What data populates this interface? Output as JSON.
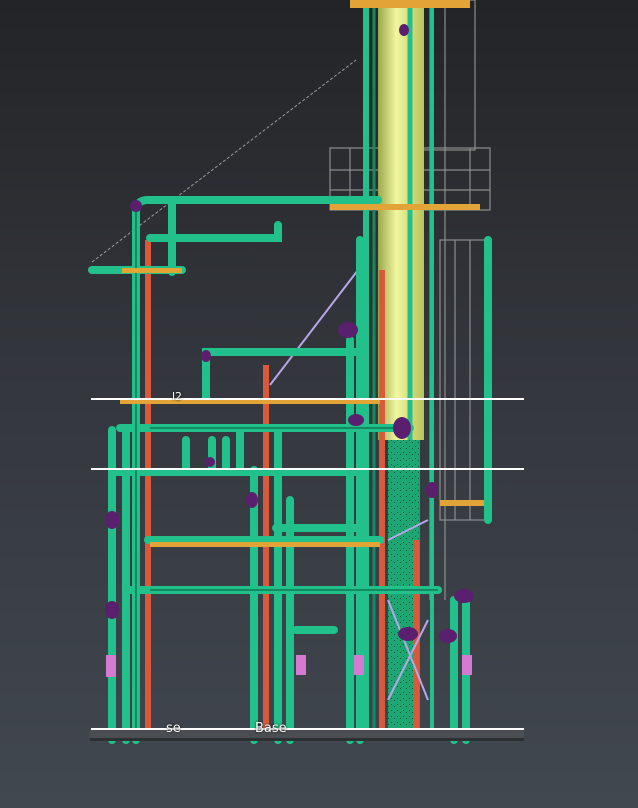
{
  "viewport": {
    "background": "#2b2d31",
    "levels": [
      {
        "label": "Base"
      },
      {
        "label": "se"
      },
      {
        "label": "l2"
      }
    ]
  },
  "colors": {
    "pipe": "#22c08a",
    "pipe_dark": "#148a60",
    "steel": "#d85a3a",
    "column": "#e6ee8a",
    "platform": "#e2a437",
    "valve": "#5a1f6e",
    "grating": "#9a9a9a",
    "guide": "#b7a6e8",
    "level_line": "#ffffff"
  }
}
